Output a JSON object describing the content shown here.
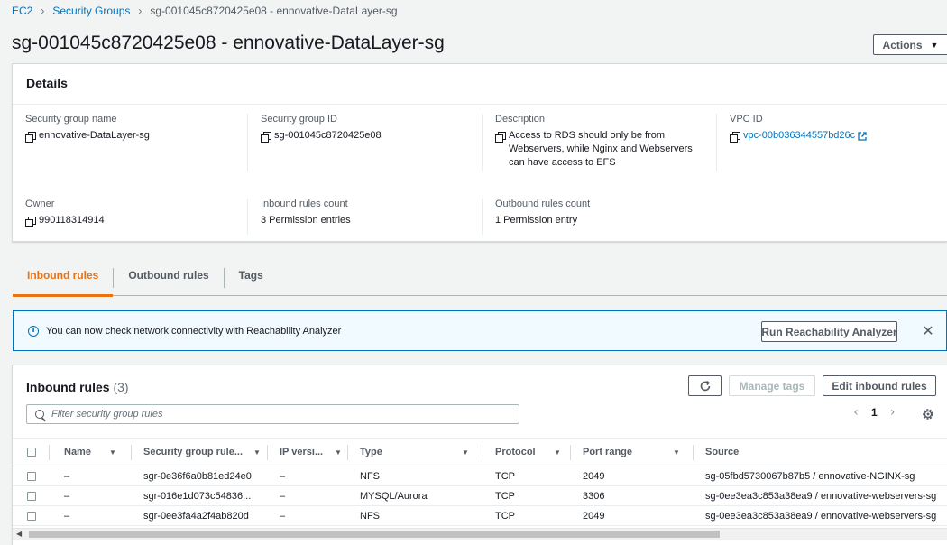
{
  "breadcrumb": {
    "items": [
      "EC2",
      "Security Groups"
    ],
    "current": "sg-001045c8720425e08 - ennovative-DataLayer-sg"
  },
  "page_title": "sg-001045c8720425e08 - ennovative-DataLayer-sg",
  "actions_label": "Actions",
  "details": {
    "title": "Details",
    "sg_name_label": "Security group name",
    "sg_name": "ennovative-DataLayer-sg",
    "sg_id_label": "Security group ID",
    "sg_id": "sg-001045c8720425e08",
    "description_label": "Description",
    "description": "Access to RDS should only be from Webservers, while Nginx and Webservers can have access to EFS",
    "vpc_label": "VPC ID",
    "vpc_id": "vpc-00b036344557bd26c",
    "owner_label": "Owner",
    "owner": "990118314914",
    "inbound_count_label": "Inbound rules count",
    "inbound_count": "3 Permission entries",
    "outbound_count_label": "Outbound rules count",
    "outbound_count": "1 Permission entry"
  },
  "tabs": [
    "Inbound rules",
    "Outbound rules",
    "Tags"
  ],
  "flash": {
    "message": "You can now check network connectivity with Reachability Analyzer",
    "button": "Run Reachability Analyzer"
  },
  "inbound": {
    "title": "Inbound rules",
    "count": "(3)",
    "manage_tags": "Manage tags",
    "edit_rules": "Edit inbound rules",
    "search_placeholder": "Filter security group rules",
    "page": "1",
    "columns": [
      "Name",
      "Security group rule...",
      "IP versi...",
      "Type",
      "Protocol",
      "Port range",
      "Source"
    ],
    "rows": [
      [
        "–",
        "sgr-0e36f6a0b81ed24e0",
        "–",
        "NFS",
        "TCP",
        "2049",
        "sg-05fbd5730067b87b5 / ennovative-NGINX-sg"
      ],
      [
        "–",
        "sgr-016e1d073c54836...",
        "–",
        "MYSQL/Aurora",
        "TCP",
        "3306",
        "sg-0ee3ea3c853a38ea9 / ennovative-webservers-sg"
      ],
      [
        "–",
        "sgr-0ee3fa4a2f4ab820d",
        "–",
        "NFS",
        "TCP",
        "2049",
        "sg-0ee3ea3c853a38ea9 / ennovative-webservers-sg"
      ]
    ]
  },
  "colors": {
    "link": "#0073bb",
    "active_tab": "#ec7211",
    "flash_bg": "#f1faff"
  }
}
